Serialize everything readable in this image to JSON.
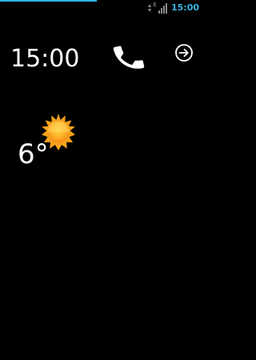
{
  "status_bar": {
    "network_type": "E",
    "time": "15:00",
    "accent_color": "#33b5e5",
    "icons": [
      "data-activity-icon",
      "signal-strength-icon"
    ]
  },
  "lockscreen": {
    "clock": "15:00",
    "call_action_icon": "phone-icon",
    "next_action_icon": "arrow-right-circle-icon"
  },
  "weather": {
    "condition_icon": "sun-icon",
    "temperature": "6°"
  },
  "colors": {
    "background": "#000000",
    "text": "#ffffff",
    "sun_outer": "#f9a51a",
    "sun_inner": "#ffcc33"
  }
}
